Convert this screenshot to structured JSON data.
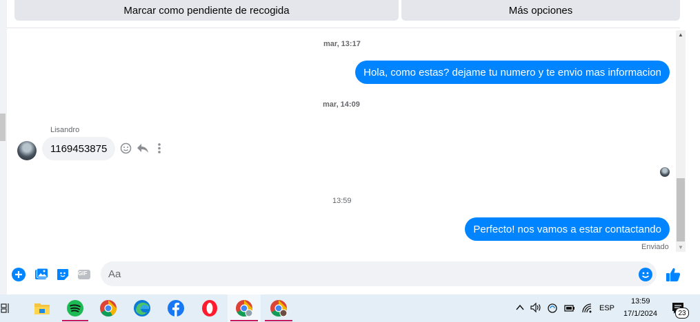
{
  "top_buttons": {
    "mark_pending": "Marcar como pendiente de recogida",
    "more_options": "Más opciones"
  },
  "chat": {
    "timestamp_1": "mar, 13:17",
    "out_msg_1": "Hola, como estas? dejame tu numero y te envio mas informacion",
    "timestamp_2": "mar, 14:09",
    "sender_name": "Lisandro",
    "in_msg_1": "1169453875",
    "timestamp_3": "13:59",
    "out_msg_2": "Perfecto! nos vamos a estar contactando",
    "sent_status": "Enviado"
  },
  "composer": {
    "placeholder": "Aa",
    "gif_label": "GIF",
    "accent": "#0084ff"
  },
  "taskbar": {
    "apps": [
      "file-explorer-icon",
      "spotify-icon",
      "chrome-icon",
      "edge-icon",
      "facebook-icon",
      "opera-icon",
      "chrome-profile-1-icon",
      "chrome-profile-2-icon"
    ],
    "language": "ESP",
    "time": "13:59",
    "date": "17/1/2024",
    "notification_count": "23"
  }
}
